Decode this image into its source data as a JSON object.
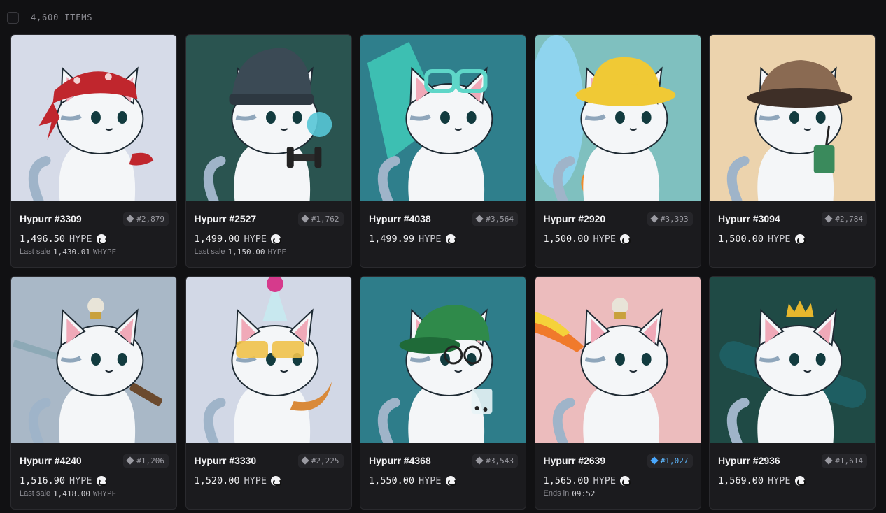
{
  "header": {
    "item_count": "4,600 ITEMS"
  },
  "currency_label": "HYPE",
  "cards": [
    {
      "name": "Hypurr #3309",
      "rank": "#2,879",
      "rank_style": "gray",
      "price": "1,496.50",
      "unit": "HYPE",
      "sub_label": "Last sale",
      "sub_value": "1,430.01",
      "sub_unit": "WHYPE",
      "bg": "#d6dbe8",
      "hat": "bandana",
      "hat_color": "#c0262d",
      "item": "pepper"
    },
    {
      "name": "Hypurr #2527",
      "rank": "#1,762",
      "rank_style": "gray",
      "price": "1,499.00",
      "unit": "HYPE",
      "sub_label": "Last sale",
      "sub_value": "1,150.00",
      "sub_unit": "HYPE",
      "bg": "#2a5450",
      "hat": "beanie",
      "hat_color": "#3b4a55",
      "item": "dumbbell"
    },
    {
      "name": "Hypurr #4038",
      "rank": "#3,564",
      "rank_style": "gray",
      "price": "1,499.99",
      "unit": "HYPE",
      "sub_label": "",
      "sub_value": "",
      "sub_unit": "",
      "bg": "#2f7f8c",
      "hat": "goggles",
      "hat_color": "#5ed6c8",
      "item": "kite"
    },
    {
      "name": "Hypurr #2920",
      "rank": "#3,393",
      "rank_style": "gray",
      "price": "1,500.00",
      "unit": "HYPE",
      "sub_label": "",
      "sub_value": "",
      "sub_unit": "",
      "bg": "#7fc0bf",
      "hat": "bucket",
      "hat_color": "#f0c935",
      "item": "surfboard"
    },
    {
      "name": "Hypurr #3094",
      "rank": "#2,784",
      "rank_style": "gray",
      "price": "1,500.00",
      "unit": "HYPE",
      "sub_label": "",
      "sub_value": "",
      "sub_unit": "",
      "bg": "#ecd3ad",
      "hat": "deerstalker",
      "hat_color": "#8a6a52",
      "item": "drink"
    },
    {
      "name": "Hypurr #4240",
      "rank": "#1,206",
      "rank_style": "gray",
      "price": "1,516.90",
      "unit": "HYPE",
      "sub_label": "Last sale",
      "sub_value": "1,418.00",
      "sub_unit": "WHYPE",
      "bg": "#a9b8c7",
      "hat": "topknot",
      "hat_color": "#e8e4d8",
      "item": "sword"
    },
    {
      "name": "Hypurr #3330",
      "rank": "#2,225",
      "rank_style": "gray",
      "price": "1,520.00",
      "unit": "HYPE",
      "sub_label": "",
      "sub_value": "",
      "sub_unit": "",
      "bg": "#d2d8e6",
      "hat": "party",
      "hat_color": "#c8e8ef",
      "item": "croissant"
    },
    {
      "name": "Hypurr #4368",
      "rank": "#3,543",
      "rank_style": "gray",
      "price": "1,550.00",
      "unit": "HYPE",
      "sub_label": "",
      "sub_value": "",
      "sub_unit": "",
      "bg": "#2e7d8a",
      "hat": "cap",
      "hat_color": "#2f8a4a",
      "item": "boba"
    },
    {
      "name": "Hypurr #2639",
      "rank": "#1,027",
      "rank_style": "blue",
      "price": "1,565.00",
      "unit": "HYPE",
      "sub_label": "Ends in",
      "sub_value": "09:52",
      "sub_unit": "",
      "bg": "#ecbcbd",
      "hat": "topknot",
      "hat_color": "#e8e4d8",
      "item": "flamesword"
    },
    {
      "name": "Hypurr #2936",
      "rank": "#1,614",
      "rank_style": "gray",
      "price": "1,569.00",
      "unit": "HYPE",
      "sub_label": "",
      "sub_value": "",
      "sub_unit": "",
      "bg": "#1f4a45",
      "hat": "crown",
      "hat_color": "#e6b72d",
      "item": "skateboard"
    }
  ]
}
